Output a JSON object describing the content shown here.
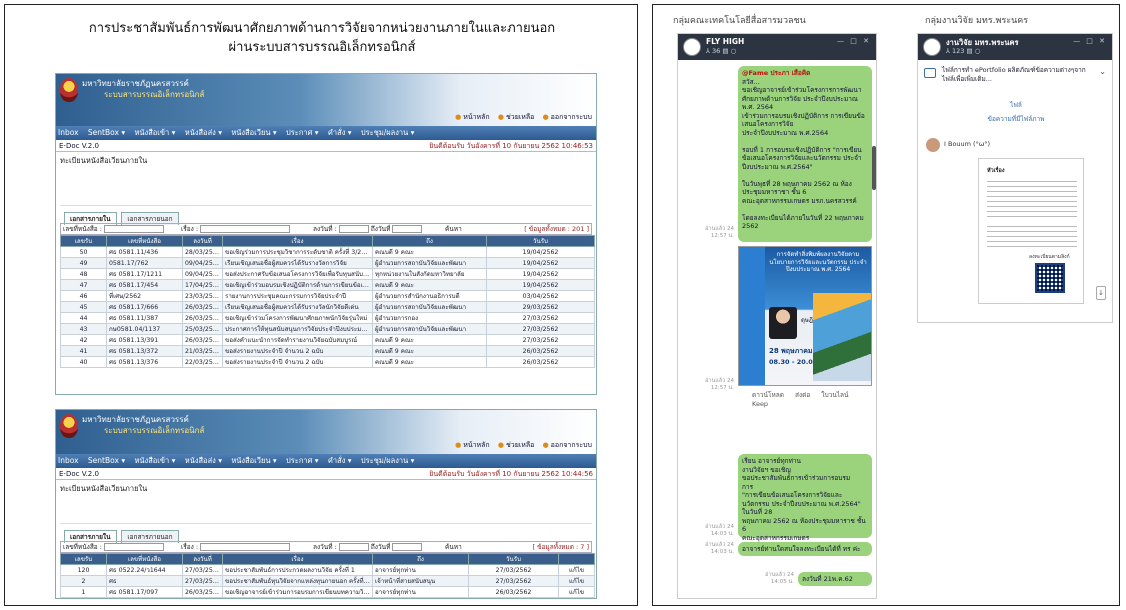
{
  "left_panel": {
    "title_line1": "การประชาสัมพันธ์การพัฒนาศักยภาพด้านการวิจัยจากหน่วยงานภายในและภายนอก",
    "title_line2": "ผ่านระบบสารบรรณอิเล็กทรอนิกส์",
    "windows": [
      {
        "brand_line1": "มหาวิทยาลัยราชภัฏนครสวรรค์",
        "brand_line2": "ระบบสารบรรณอิเล็กทรอนิกส์",
        "toplinks": [
          "หน้าหลัก",
          "ช่วยเหลือ",
          "ออกจากระบบ"
        ],
        "menu": [
          "Inbox",
          "SentBox ▾",
          "หนังสือเข้า ▾",
          "หนังสือส่ง ▾",
          "หนังสือเวียน ▾",
          "ประกาศ ▾",
          "คำสั่ง ▾",
          "ประชุม/ผลงาน ▾"
        ],
        "version": "E-Doc V.2.0",
        "date": "ยินดีต้อนรับ วันอังคารที่ 10 กันยายน 2562 10:46:53",
        "section": "ทะเบียนหนังสือเวียนภายใน",
        "tabs": [
          "เอกสารภายใน",
          "เอกสารภายนอก"
        ],
        "filter_labels": [
          "เลขที่หนังสือ :",
          "เรื่อง :",
          "ลงวันที่ :",
          "ถึงวันที่",
          "ค้นหา"
        ],
        "count": "[ ข้อมูลทั้งหมด : 201 ]",
        "headers": [
          "เลขรับ",
          "เลขที่หนังสือ",
          "ลงวันที่",
          "เรื่อง",
          "ถึง",
          "วันรับ"
        ],
        "rows": [
          [
            "50",
            "ศธ 0581.11/436",
            "28/03/2562",
            "ขอเชิญร่วมการประชุมวิชาการระดับชาติ ครั้งที่ 3/2562",
            "คณบดี 9 คณะ",
            "19/04/2562"
          ],
          [
            "49",
            "0581.17/762",
            "09/04/2562",
            "เรียนเชิญเสนอชื่อผู้สมควรได้รับรางวัลการวิจัย",
            "ผู้อำนวยการสถาบันวิจัยและพัฒนา",
            "19/04/2562"
          ],
          [
            "48",
            "ศธ 0581.17/1211",
            "09/04/2562",
            "ขอส่งประกาศรับข้อเสนอโครงการวิจัยเพื่อรับทุนสนับสนุน ครั้งที่ 1",
            "ทุกหน่วยงานในสังกัดมหาวิทยาลัย",
            "19/04/2562"
          ],
          [
            "47",
            "ศธ 0581.17/454",
            "17/04/2562",
            "ขอเชิญเข้าร่วมอบรมเชิงปฏิบัติการด้านการเขียนข้อเสนอ",
            "คณบดี 9 คณะ",
            "19/04/2562"
          ],
          [
            "46",
            "ที่เศษ/2562",
            "23/03/2562",
            "รายงานการประชุมคณะกรรมการวิจัยประจำปี",
            "ผู้อำนวยการสำนักงานอธิการบดี",
            "03/04/2562"
          ],
          [
            "45",
            "ศธ 0581.17/666",
            "26/03/2562",
            "เรียนเชิญเสนอชื่อผู้สมควรได้รับรางวัลนักวิจัยดีเด่น",
            "ผู้อำนวยการสถาบันวิจัยและพัฒนา",
            "29/03/2562"
          ],
          [
            "44",
            "ศธ 0581.11/387",
            "26/03/2562",
            "ขอเชิญเข้าร่วมโครงการพัฒนาศักยภาพนักวิจัยรุ่นใหม่",
            "ผู้อำนวยการกอง",
            "27/03/2562"
          ],
          [
            "43",
            "กษ0581.04/1137",
            "25/03/2562",
            "ประกาศการให้ทุนสนับสนุนการวิจัยประจำปีงบประมาณ",
            "ผู้อำนวยการสถาบันวิจัยและพัฒนา",
            "27/03/2562"
          ],
          [
            "42",
            "ศธ 0581.13/391",
            "26/03/2562",
            "ขอส่งคำแนะนำการจัดทำรายงานวิจัยฉบับสมบูรณ์",
            "คณบดี 9 คณะ",
            "27/03/2562"
          ],
          [
            "41",
            "ศธ 0581.13/372",
            "21/03/2562",
            "ขอส่งรายงานประจำปี จำนวน 2 ฉบับ",
            "คณบดี 9 คณะ",
            "26/03/2562"
          ],
          [
            "40",
            "ศธ 0581.13/376",
            "22/03/2562",
            "ขอส่งรายงานประจำปี จำนวน 2 ฉบับ",
            "คณบดี 9 คณะ",
            "26/03/2562"
          ]
        ]
      },
      {
        "brand_line1": "มหาวิทยาลัยราชภัฏนครสวรรค์",
        "brand_line2": "ระบบสารบรรณอิเล็กทรอนิกส์",
        "toplinks": [
          "หน้าหลัก",
          "ช่วยเหลือ",
          "ออกจากระบบ"
        ],
        "menu": [
          "Inbox",
          "SentBox ▾",
          "หนังสือเข้า ▾",
          "หนังสือส่ง ▾",
          "หนังสือเวียน ▾",
          "ประกาศ ▾",
          "คำสั่ง ▾",
          "ประชุม/ผลงาน ▾"
        ],
        "version": "E-Doc V.2.0",
        "date": "ยินดีต้อนรับ วันอังคารที่ 10 กันยายน 2562 10:44:56",
        "section": "ทะเบียนหนังสือเวียนภายใน",
        "tabs": [
          "เอกสารภายใน",
          "เอกสารภายนอก"
        ],
        "filter_labels": [
          "เลขที่หนังสือ :",
          "เรื่อง :",
          "ลงวันที่ :",
          "ถึงวันที่",
          "ค้นหา"
        ],
        "count": "[ ข้อมูลทั้งหมด : 7 ]",
        "headers": [
          "เลขรับ",
          "เลขที่หนังสือ",
          "ลงวันที่",
          "เรื่อง",
          "ถึง",
          "วันรับ",
          ""
        ],
        "rows": [
          [
            "120",
            "ศธ 0522.24/ว1644",
            "27/03/2562",
            "ขอประชาสัมพันธ์การประกวดผลงานวิจัย ครั้งที่ 1",
            "อาจารย์ทุกท่าน",
            "27/03/2562",
            "แก้ไข"
          ],
          [
            "2",
            "ศธ",
            "27/03/2562",
            "ขอประชาสัมพันธ์ทุนวิจัยจากแหล่งทุนภายนอก ครั้งที่ 11",
            "เจ้าหน้าที่สายสนับสนุน",
            "27/03/2562",
            "แก้ไข"
          ],
          [
            "1",
            "ศธ 0581.17/097",
            "26/03/2562",
            "ขอเชิญอาจารย์เข้าร่วมการอบรมการเขียนบทความวิจัย",
            "อาจารย์ทุกท่าน",
            "26/03/2562",
            "แก้ไข"
          ]
        ]
      }
    ]
  },
  "right_panel": {
    "chats": [
      {
        "label": "กลุ่มคณะเทคโนโลยีสื่อสารมวลชน",
        "name": "FLY HIGH",
        "members": "⅄ 36  ▤  ○",
        "controls": "— □ ✕",
        "messages": [
          {
            "mention": "@Fame ประภา เสือคิด",
            "text": "สวัส...\nขอเชิญอาจารย์เข้าร่วมโครงการการพัฒนาศักยภาพด้านการวิจัย ประจำปีงบประมาณ พ.ศ. 2564\nเข้าร่วมการอบรมเชิงปฏิบัติการ การเขียนข้อเสนอโครงการวิจัย\nประจำปีงบประมาณ พ.ศ.2564\n\nรอบที่ 1 การอบรมเชิงปฏิบัติการ \"การเขียนข้อเสนอโครงการวิจัยและนวัตกรรม ประจำปีงบประมาณ พ.ศ.2564\"\n\nในวันพุธที่ 28 พฤษภาคม 2562 ณ ห้องประชุมมหาราชา ชั้น 6\nคณะอุตสาหกรรมเกษตร มรภ.นครสวรรค์\n\nโดยลงทะเบียนได้ภายในวันที่ 22 พฤษภาคม 2562",
            "time": "อ่านแล้ว 24\n12:57 น."
          },
          {
            "poster_title": "การจัดทำสิ่งพิมพ์ผลงานวิจัยตามนโยบายการวิจัยและนวัตกรรม ประจำปีงบประมาณ พ.ศ. 2564",
            "speaker": "ดุษฎี เกษตรนิยม",
            "date": "28 พฤษภาคม 2562",
            "time_range": "08.30 - 20.00 น.",
            "time": "อ่านแล้ว 24\n12:57 น."
          },
          {
            "text": "เรียน อาจารย์ทุกท่าน\nงานวิจัยฯ ขอเชิญ\nขอประชาสัมพันธ์การเข้าร่วมการอบรม\nการ\n\"การเขียนข้อเสนอโครงการวิจัยและนวัตกรรม ประจำปีงบประมาณ พ.ศ.2564\" ในวันที่ 28\nพฤษภาคม 2562 ณ ห้องประชุมมหาราช ชั้น 6\nคณะอุตสาหกรรมเกษตร",
            "time": "อ่านแล้ว 24\n14:03 น."
          },
          {
            "text": "อาจารย์ท่านใดสนใจลงทะเบียนได้ที่ ทร ค่ะ",
            "time": "อ่านแล้ว 24\n14:03 น."
          },
          {
            "text": "ลงวันที่ 21พ.ค.62",
            "time": "อ่านแล้ว 24\n14:05 น."
          }
        ],
        "actions": [
          "ดาวน์โหลด",
          "ส่งต่อ",
          "ใบวนไลน์",
          "Keep"
        ]
      },
      {
        "label": "กลุ่มงานวิจัย มทร.พระนคร",
        "name": "งานวิจัย มทร.พระนคร",
        "members": "⅄ 123  ▤  ○",
        "controls": "— □ ✕",
        "announcement": "ไฟล์การทำ ePortfolio ผลิตภัณฑ์ข้อความต่างๆจากไฟล์เพื่อเพิ่มเติม...",
        "announce_sub": "ไฟล์",
        "announce_link": "ข้อความที่มีไฟล์ภาพ",
        "sender": "I Bouum (°ω°)",
        "doc_title": "หัวเรื่อง",
        "doc_caption": "ลงทะเบียนตามลิงก์"
      }
    ]
  }
}
